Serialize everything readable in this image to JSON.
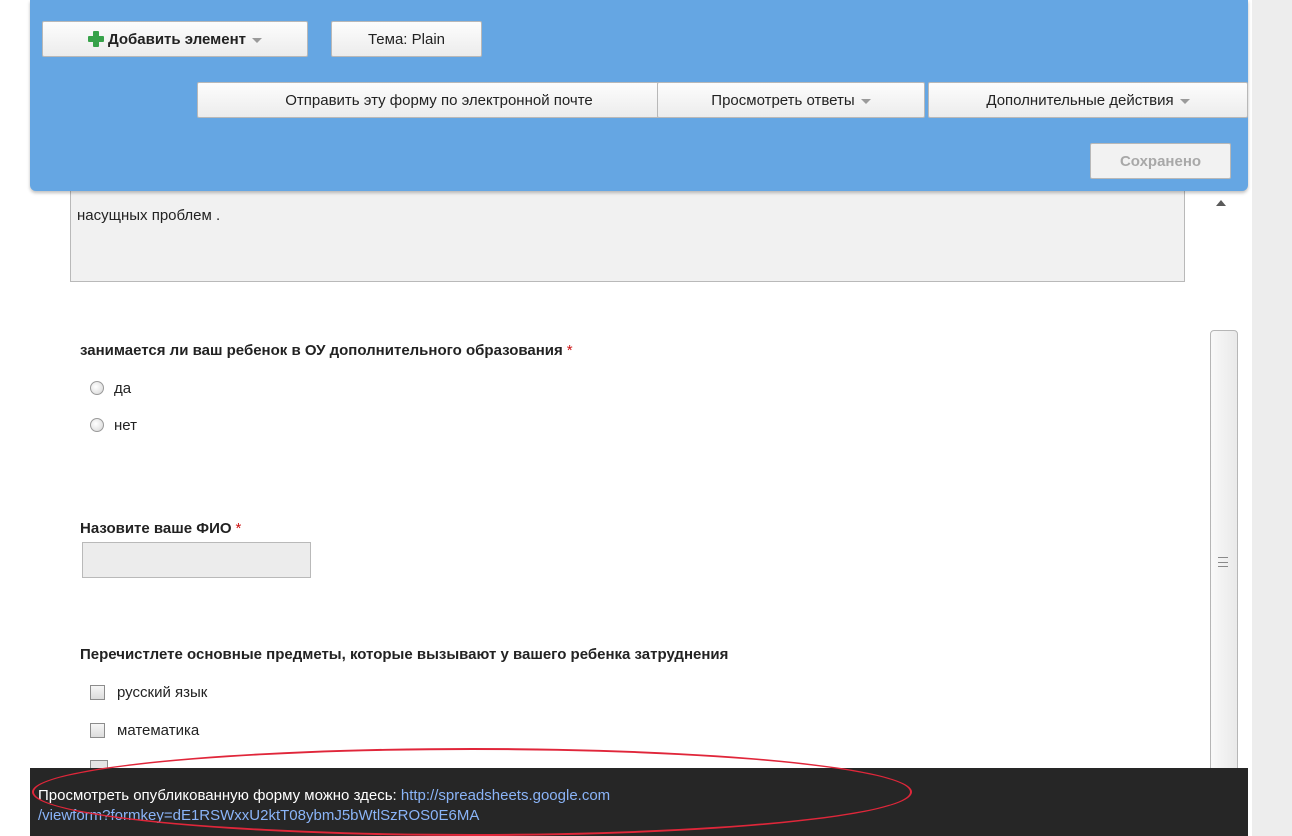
{
  "toolbar": {
    "add_element": "Добавить элемент",
    "theme": "Тема:  Plain",
    "send_email": "Отправить эту форму по электронной почте",
    "view_responses": "Просмотреть ответы",
    "more_actions": "Дополнительные действия",
    "saved": "Сохранено"
  },
  "description": {
    "text": "насущных проблем ."
  },
  "questions": [
    {
      "title": "занимается ли ваш ребенок в ОУ дополнительного образования",
      "required": "*",
      "options": [
        "да",
        "нет"
      ]
    },
    {
      "title": "Назовите ваше ФИО",
      "required": "*",
      "value": ""
    },
    {
      "title": "Перечистлете основные предметы, которые вызывают у вашего ребенка затруднения",
      "options": [
        "русский язык",
        "математика"
      ]
    }
  ],
  "footer": {
    "text": "Просмотреть опубликованную форму можно здесь:",
    "link_line1": "http://spreadsheets.google.com",
    "link_line2": "/viewform?formkey=dE1RSWxxU2ktT08ybmJ5bWtlSzROS0E6MA"
  },
  "colors": {
    "toolbar_bg": "#65a6e3",
    "required": "#c11111",
    "footer_bg": "#262626",
    "link": "#8ab4f8",
    "annotation": "#e0263a"
  }
}
